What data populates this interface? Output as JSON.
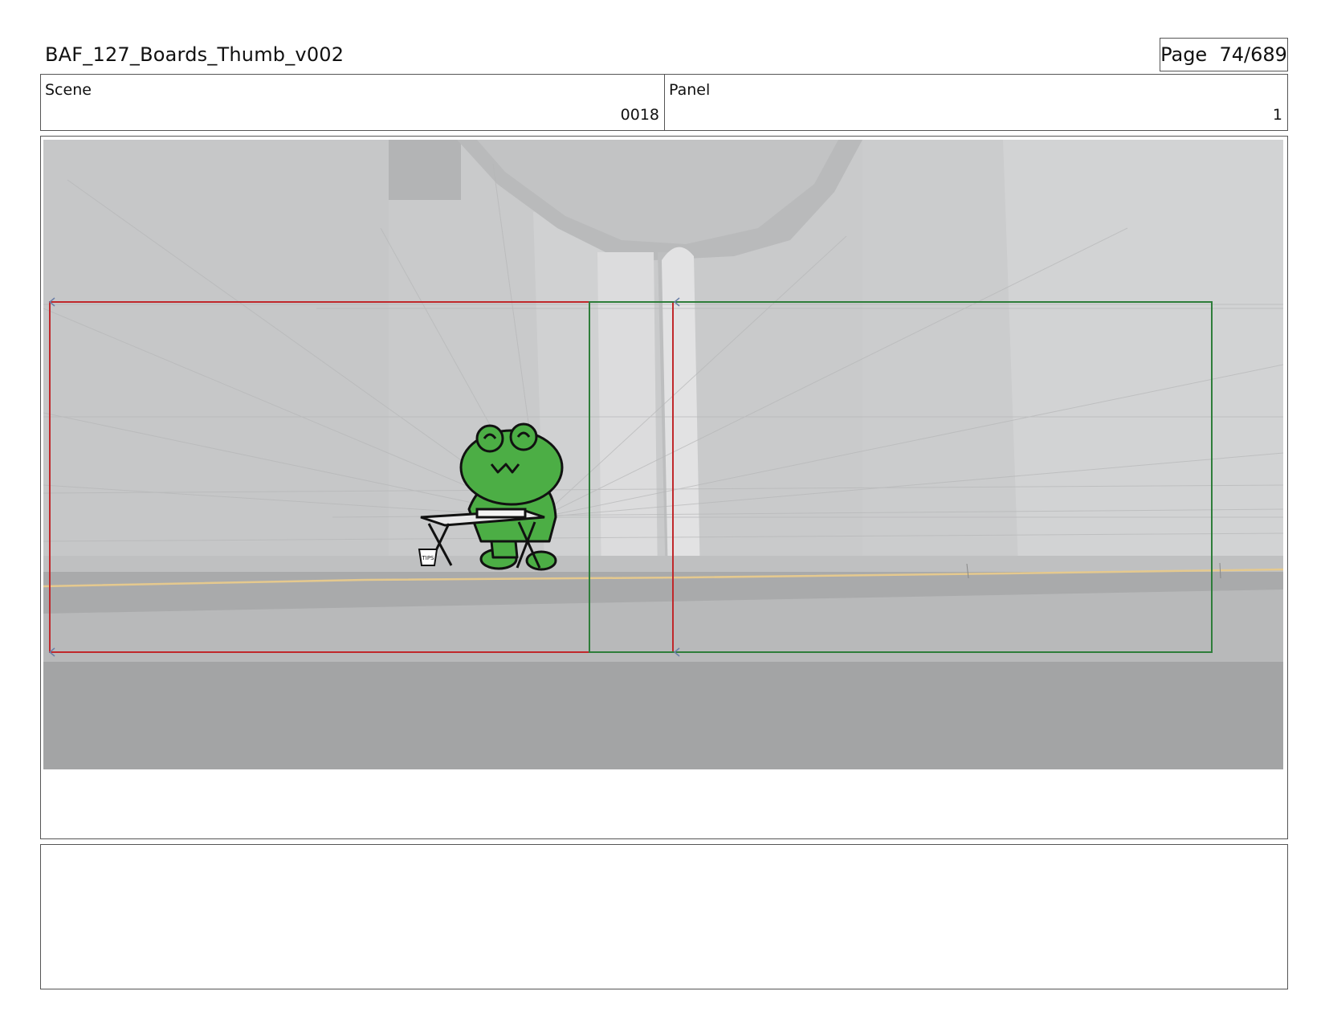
{
  "header": {
    "document_title": "BAF_127_Boards_Thumb_v002",
    "page_label": "Page",
    "page_number": "74/689"
  },
  "info": {
    "scene_label": "Scene",
    "scene_value": "0018",
    "panel_label": "Panel",
    "panel_value": "1"
  },
  "frame": {
    "props": {
      "tip_jar_text": "TIPS"
    },
    "colors": {
      "safe_frame_red": "#c0282b",
      "safe_frame_green": "#2e7d3a",
      "frog_green": "#4cae45",
      "road_line": "#e5c98e",
      "background_gray": "#cfcfcf"
    }
  },
  "notes": {
    "text": ""
  }
}
